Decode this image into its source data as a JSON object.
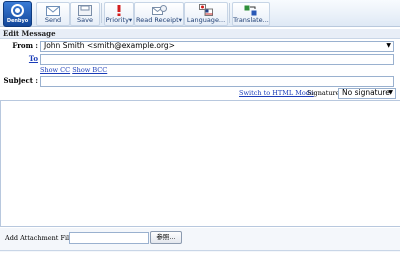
{
  "toolbar": {
    "logo_text": "Denbyo",
    "buttons": [
      {
        "label": "Send"
      },
      {
        "label": "Save"
      },
      {
        "label": "Priority▾"
      },
      {
        "label": "Read Receipt▾"
      },
      {
        "label": "Language..."
      },
      {
        "label": "Translate..."
      }
    ]
  },
  "section_title": "Edit Message",
  "form": {
    "from_label": "From :",
    "from_value": "John Smith <smith@example.org>",
    "to_label": "To",
    "show_cc": "Show CC",
    "show_bcc": "Show BCC",
    "subject_label": "Subject :",
    "subject_value": ""
  },
  "editor": {
    "switch_link": "Switch to HTML Mode",
    "signature_label": "Signature :",
    "signature_value": "No signature"
  },
  "attachment": {
    "label": "Add Attachment File :",
    "browse_label": "参照..."
  },
  "colors": {
    "toolbar_bg": "#dfe9f5",
    "link": "#1a3cb8",
    "border": "#9ab1cf"
  }
}
